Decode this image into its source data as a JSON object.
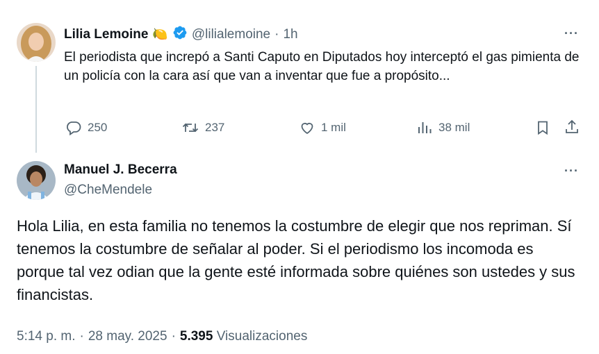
{
  "tweet": {
    "author_name": "Lilia Lemoine",
    "author_emoji": "🍋",
    "author_handle": "@lilialemoine",
    "separator": "·",
    "time_ago": "1h",
    "text": "El periodista que increpó a Santi Caputo en Diputados hoy interceptó el gas pimienta de un policía con la cara así que van a inventar que fue a propósito...",
    "actions": {
      "replies": "250",
      "reposts": "237",
      "likes": "1 mil",
      "views": "38 mil"
    },
    "more_label": "···"
  },
  "reply": {
    "author_name": "Manuel J. Becerra",
    "author_handle": "@CheMendele",
    "more_label": "···",
    "text": "Hola Lilia, en esta familia no tenemos la costumbre de elegir que nos repriman. Sí tenemos la costumbre de señalar al poder. Si el periodismo los incomoda es porque tal vez odian que la gente esté informada sobre quiénes son ustedes y sus financistas.",
    "time": "5:14 p. m.",
    "sep1": "·",
    "date": "28 may. 2025",
    "sep2": "·",
    "views_count": "5.395",
    "views_label": "Visualizaciones"
  },
  "colors": {
    "text": "#0f1419",
    "muted": "#536471",
    "verified": "#1d9bf0",
    "thread_line": "#cfd9de"
  },
  "icons": [
    "reply-icon",
    "repost-icon",
    "like-icon",
    "views-icon",
    "bookmark-icon",
    "share-icon",
    "verified-badge-icon",
    "more-icon"
  ]
}
